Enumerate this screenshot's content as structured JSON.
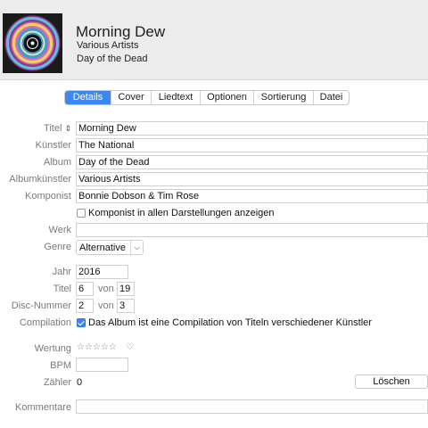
{
  "header": {
    "title": "Morning Dew",
    "artist": "Various Artists",
    "album": "Day of the Dead"
  },
  "tabs": [
    {
      "label": "Details",
      "active": true
    },
    {
      "label": "Cover",
      "active": false
    },
    {
      "label": "Liedtext",
      "active": false
    },
    {
      "label": "Optionen",
      "active": false
    },
    {
      "label": "Sortierung",
      "active": false
    },
    {
      "label": "Datei",
      "active": false
    }
  ],
  "labels": {
    "title": "Titel",
    "artist": "Künstler",
    "album": "Album",
    "album_artist": "Albumkünstler",
    "composer": "Komponist",
    "work": "Werk",
    "genre": "Genre",
    "year": "Jahr",
    "track": "Titel",
    "disc": "Disc-Nummer",
    "compilation": "Compilation",
    "rating": "Wertung",
    "bpm": "BPM",
    "plays": "Zähler",
    "comments": "Kommentare",
    "of": "von"
  },
  "fields": {
    "title": "Morning Dew",
    "artist": "The National",
    "album": "Day of the Dead",
    "album_artist": "Various Artists",
    "composer": "Bonnie Dobson & Tim Rose",
    "work": "",
    "genre": "Alternative",
    "year": "2016",
    "track_number": "6",
    "track_total": "19",
    "disc_number": "2",
    "disc_total": "3",
    "bpm": "",
    "play_count": "0",
    "comments": ""
  },
  "checkboxes": {
    "composer_show_all": {
      "label": "Komponist in allen Darstellungen anzeigen",
      "checked": false
    },
    "compilation": {
      "label": "Das Album ist eine Compilation von Titeln verschiedener Künstler",
      "checked": true
    }
  },
  "rating": {
    "stars": "☆☆☆☆☆",
    "heart": "♡"
  },
  "buttons": {
    "reset_plays": "Löschen"
  },
  "icons": {
    "sort": "sort-updown-icon",
    "chevron": "chevron-down-icon",
    "star": "star-outline-icon",
    "heart": "heart-outline-icon"
  },
  "colors": {
    "accent": "#3b88f5",
    "header_bg": "#ececec",
    "label": "#7a7a7a"
  }
}
